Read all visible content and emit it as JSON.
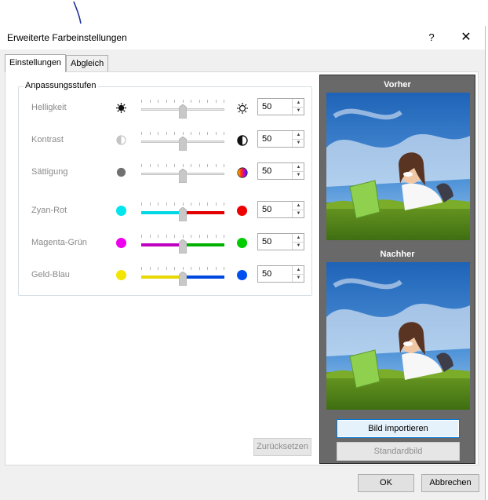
{
  "window": {
    "title": "Erweiterte Farbeinstellungen",
    "help": "?",
    "close": "✕"
  },
  "tabs": [
    {
      "label": "Einstellungen",
      "active": true
    },
    {
      "label": "Abgleich",
      "active": false
    }
  ],
  "group": {
    "label": "Anpassungsstufen",
    "rows": [
      {
        "label": "Helligkeit",
        "value": "50",
        "level": 0.5,
        "left_icon": "sun-dark-icon",
        "right_icon": "sun-outline-icon"
      },
      {
        "label": "Kontrast",
        "value": "50",
        "level": 0.5,
        "left_icon": "contrast-low-icon",
        "right_icon": "contrast-high-icon"
      },
      {
        "label": "Sättigung",
        "value": "50",
        "level": 0.5,
        "left_icon": "gray-dot-icon",
        "right_icon": "color-wheel-icon"
      },
      {
        "label": "Zyan-Rot",
        "value": "50",
        "level": 0.5,
        "left_color": "#00e5ee",
        "right_color": "#ee0000"
      },
      {
        "label": "Magenta-Grün",
        "value": "50",
        "level": 0.5,
        "left_color": "#ee00ee",
        "right_color": "#00cc00"
      },
      {
        "label": "Geld-Blau",
        "value": "50",
        "level": 0.5,
        "left_color": "#f2e600",
        "right_color": "#0050f0"
      }
    ]
  },
  "buttons": {
    "reset": "Zurücksetzen",
    "import": "Bild importieren",
    "standard": "Standardbild",
    "ok": "OK",
    "cancel": "Abbrechen"
  },
  "preview": {
    "before": "Vorher",
    "after": "Nachher"
  },
  "colors": {
    "dialog_bg": "#f0f0f0",
    "preview_bg": "#696969",
    "accent": "#0078d7"
  }
}
